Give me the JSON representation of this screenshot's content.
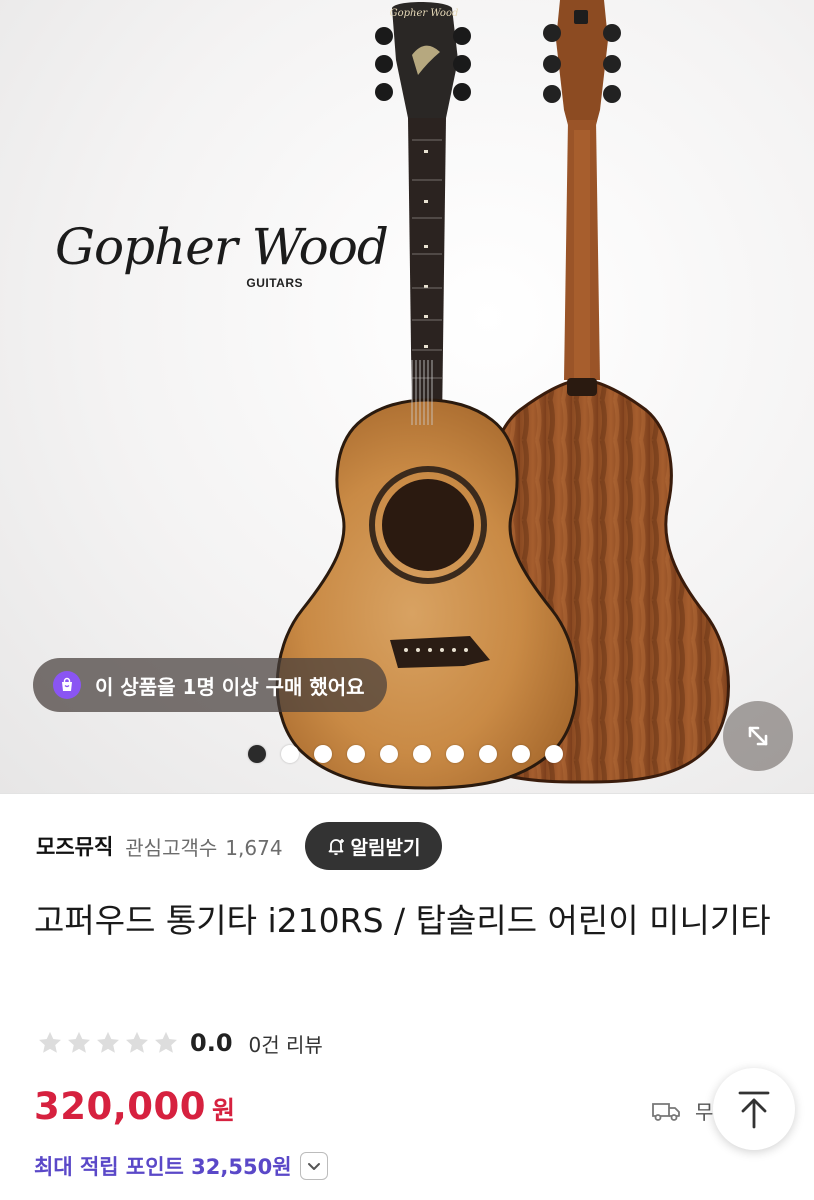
{
  "hero": {
    "brand": {
      "name": "Gopher Wood",
      "sub": "GUITARS"
    },
    "headstock_text": "Gopher Wood",
    "purchase_notice": "이 상품을 1명 이상 구매 했어요",
    "slides": {
      "count": 10,
      "active": 1
    },
    "icons": {
      "pill": "shopping-bag-icon",
      "expand": "expand-arrows-icon"
    }
  },
  "store": {
    "name": "모즈뮤직",
    "followers_label": "관심고객수",
    "followers_count": "1,674",
    "alarm_label": "알림받기",
    "alarm_icon": "bell-plus-icon"
  },
  "product": {
    "title": "고퍼우드 통기타 i210RS / 탑솔리드 어린이 미니기타",
    "rating": {
      "score": "0.0",
      "reviews": "0건 리뷰",
      "stars_filled": 0,
      "stars_total": 5
    },
    "price": {
      "value": "320,000",
      "unit": "원"
    },
    "shipping": {
      "text": "무",
      "icon": "delivery-truck-icon"
    },
    "points": {
      "text": "최대 적립 포인트 32,550원",
      "expand_icon": "chevron-down-icon"
    }
  },
  "colors": {
    "price": "#d6213f",
    "points": "#5a48c8",
    "pill_icon": "#8a55f3",
    "alarm_button": "#333333"
  },
  "scroll_top_icon": "arrow-up-to-top-icon"
}
